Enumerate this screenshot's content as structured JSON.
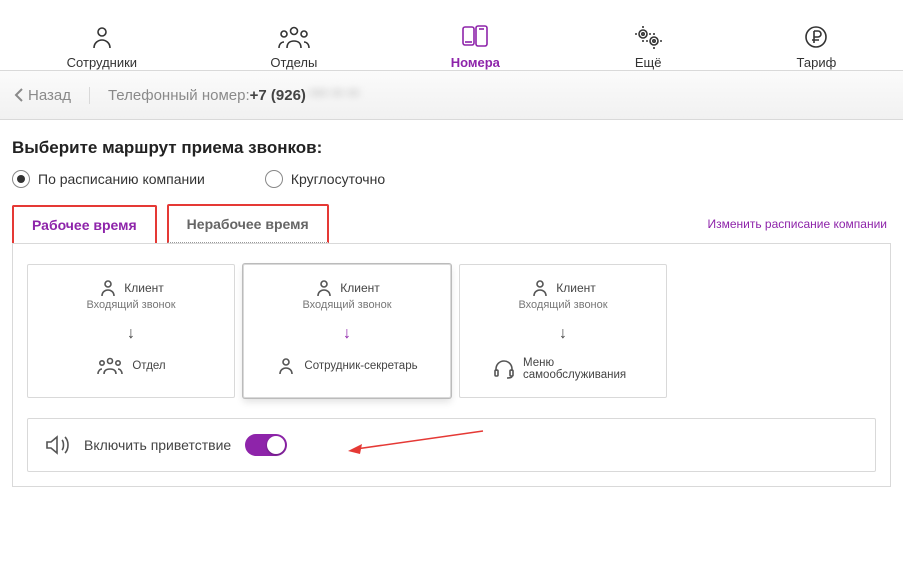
{
  "nav": {
    "items": [
      {
        "id": "employees",
        "label": "Сотрудники"
      },
      {
        "id": "departments",
        "label": "Отделы"
      },
      {
        "id": "numbers",
        "label": "Номера"
      },
      {
        "id": "more",
        "label": "Ещё"
      },
      {
        "id": "tariff",
        "label": "Тариф"
      }
    ]
  },
  "crumb": {
    "back": "Назад",
    "label": "Телефонный номер: ",
    "number": "+7 (926)",
    "masked": "*** ** **"
  },
  "heading": "Выберите маршрут приема звонков:",
  "route_options": {
    "by_schedule": "По расписанию компании",
    "all_day": "Круглосуточно"
  },
  "tabs": {
    "work": "Рабочее время",
    "off": "Нерабочее время",
    "schedule_link": "Изменить расписание компании"
  },
  "cards_common": {
    "client": "Клиент",
    "incoming": "Входящий звонок"
  },
  "cards": [
    {
      "dest": "Отдел"
    },
    {
      "dest": "Сотрудник-секретарь"
    },
    {
      "dest": "Меню самообслуживания"
    }
  ],
  "greeting": {
    "label": "Включить приветствие",
    "enabled": true
  }
}
